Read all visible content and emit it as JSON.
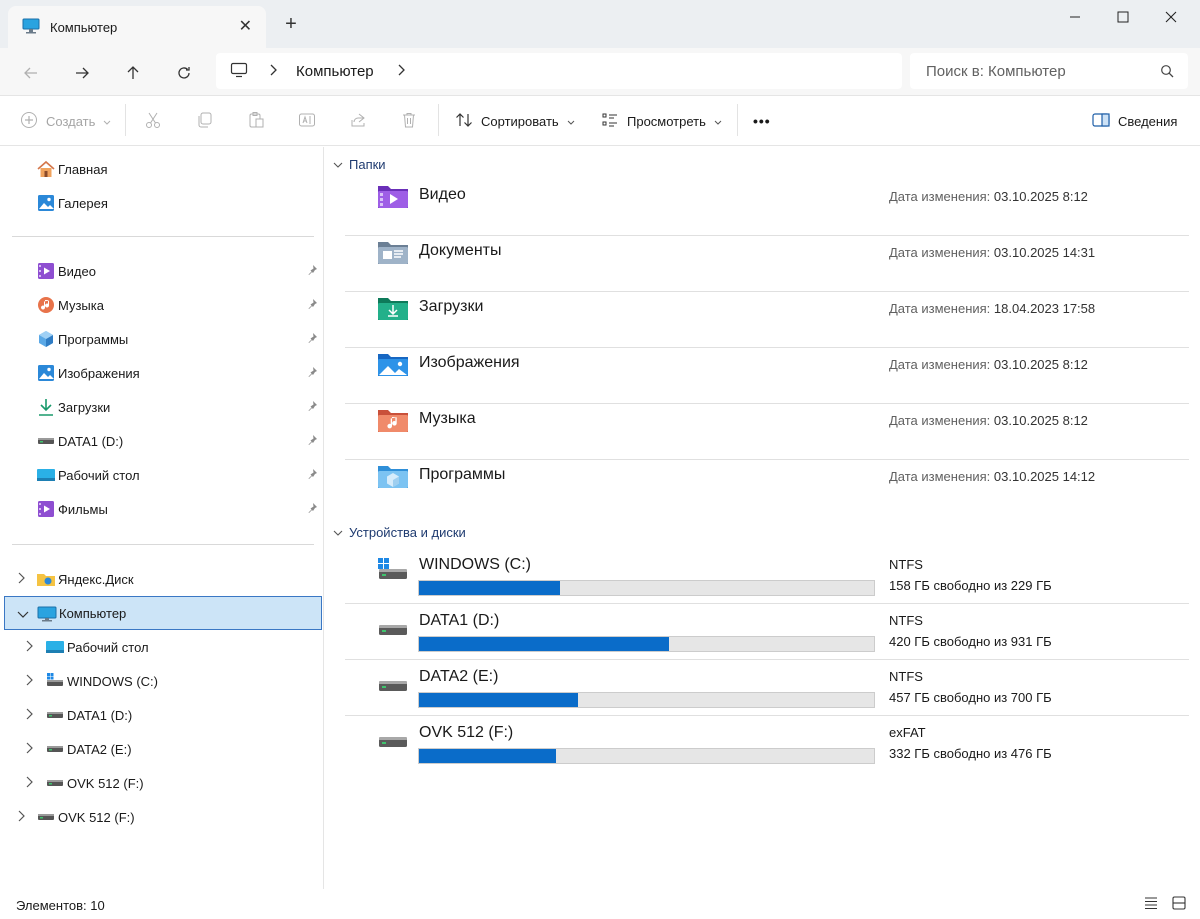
{
  "window": {
    "tab_title": "Компьютер",
    "tab_icon": "monitor-icon",
    "new_tab_symbol": "+",
    "close_symbol": "✕"
  },
  "address": {
    "crumbs": [
      "Компьютер"
    ],
    "search_placeholder": "Поиск в: Компьютер"
  },
  "toolbar": {
    "create_label": "Создать",
    "sort_label": "Сортировать",
    "view_label": "Просмотреть",
    "more_label": "•••",
    "details_label": "Сведения"
  },
  "sidebar": {
    "top": [
      {
        "label": "Главная",
        "icon": "home-icon"
      },
      {
        "label": "Галерея",
        "icon": "gallery-icon"
      }
    ],
    "pinned": [
      {
        "label": "Видео",
        "icon": "video-folder-icon"
      },
      {
        "label": "Музыка",
        "icon": "music-icon"
      },
      {
        "label": "Программы",
        "icon": "cube-icon"
      },
      {
        "label": "Изображения",
        "icon": "pictures-icon"
      },
      {
        "label": "Загрузки",
        "icon": "download-icon"
      },
      {
        "label": "DATA1 (D:)",
        "icon": "drive-icon"
      },
      {
        "label": "Рабочий стол",
        "icon": "desktop-icon"
      },
      {
        "label": "Фильмы",
        "icon": "video-folder-icon"
      }
    ],
    "tree": [
      {
        "label": "Яндекс.Диск",
        "icon": "yandex-disk-icon",
        "level": 0,
        "expanded": false
      },
      {
        "label": "Компьютер",
        "icon": "monitor-icon",
        "level": 0,
        "expanded": true,
        "selected": true
      },
      {
        "label": "Рабочий стол",
        "icon": "desktop-icon",
        "level": 1,
        "expanded": false
      },
      {
        "label": "WINDOWS (C:)",
        "icon": "windows-drive-icon",
        "level": 1,
        "expanded": false
      },
      {
        "label": "DATA1 (D:)",
        "icon": "drive-icon",
        "level": 1,
        "expanded": false
      },
      {
        "label": "DATA2 (E:)",
        "icon": "drive-icon",
        "level": 1,
        "expanded": false
      },
      {
        "label": "OVK 512 (F:)",
        "icon": "drive-icon",
        "level": 1,
        "expanded": false
      },
      {
        "label": "OVK 512 (F:)",
        "icon": "drive-icon",
        "level": 0,
        "expanded": false
      }
    ]
  },
  "main": {
    "folders_header": "Папки",
    "date_label": "Дата изменения:",
    "folders": [
      {
        "name": "Видео",
        "date": "03.10.2025 8:12",
        "icon": "video-folder-icon"
      },
      {
        "name": "Документы",
        "date": "03.10.2025 14:31",
        "icon": "documents-folder-icon"
      },
      {
        "name": "Загрузки",
        "date": "18.04.2023 17:58",
        "icon": "downloads-folder-icon"
      },
      {
        "name": "Изображения",
        "date": "03.10.2025 8:12",
        "icon": "pictures-folder-icon"
      },
      {
        "name": "Музыка",
        "date": "03.10.2025 8:12",
        "icon": "music-folder-icon"
      },
      {
        "name": "Программы",
        "date": "03.10.2025 14:12",
        "icon": "programs-folder-icon"
      }
    ],
    "drives_header": "Устройства и диски",
    "drives": [
      {
        "name": "WINDOWS (C:)",
        "fs": "NTFS",
        "free": "158 ГБ свободно из 229 ГБ",
        "used_fraction": 0.31,
        "icon": "windows-drive-icon"
      },
      {
        "name": "DATA1 (D:)",
        "fs": "NTFS",
        "free": "420 ГБ свободно из 931 ГБ",
        "used_fraction": 0.55,
        "icon": "drive-icon"
      },
      {
        "name": "DATA2 (E:)",
        "fs": "NTFS",
        "free": "457 ГБ свободно из 700 ГБ",
        "used_fraction": 0.35,
        "icon": "drive-icon"
      },
      {
        "name": "OVK 512 (F:)",
        "fs": "exFAT",
        "free": "332 ГБ свободно из 476 ГБ",
        "used_fraction": 0.3,
        "icon": "drive-icon"
      }
    ]
  },
  "status": {
    "count": "Элементов: 10"
  },
  "colors": {
    "accent": "#0a6cc9",
    "selection": "#cce4f7",
    "header_text": "#1f3b70"
  }
}
